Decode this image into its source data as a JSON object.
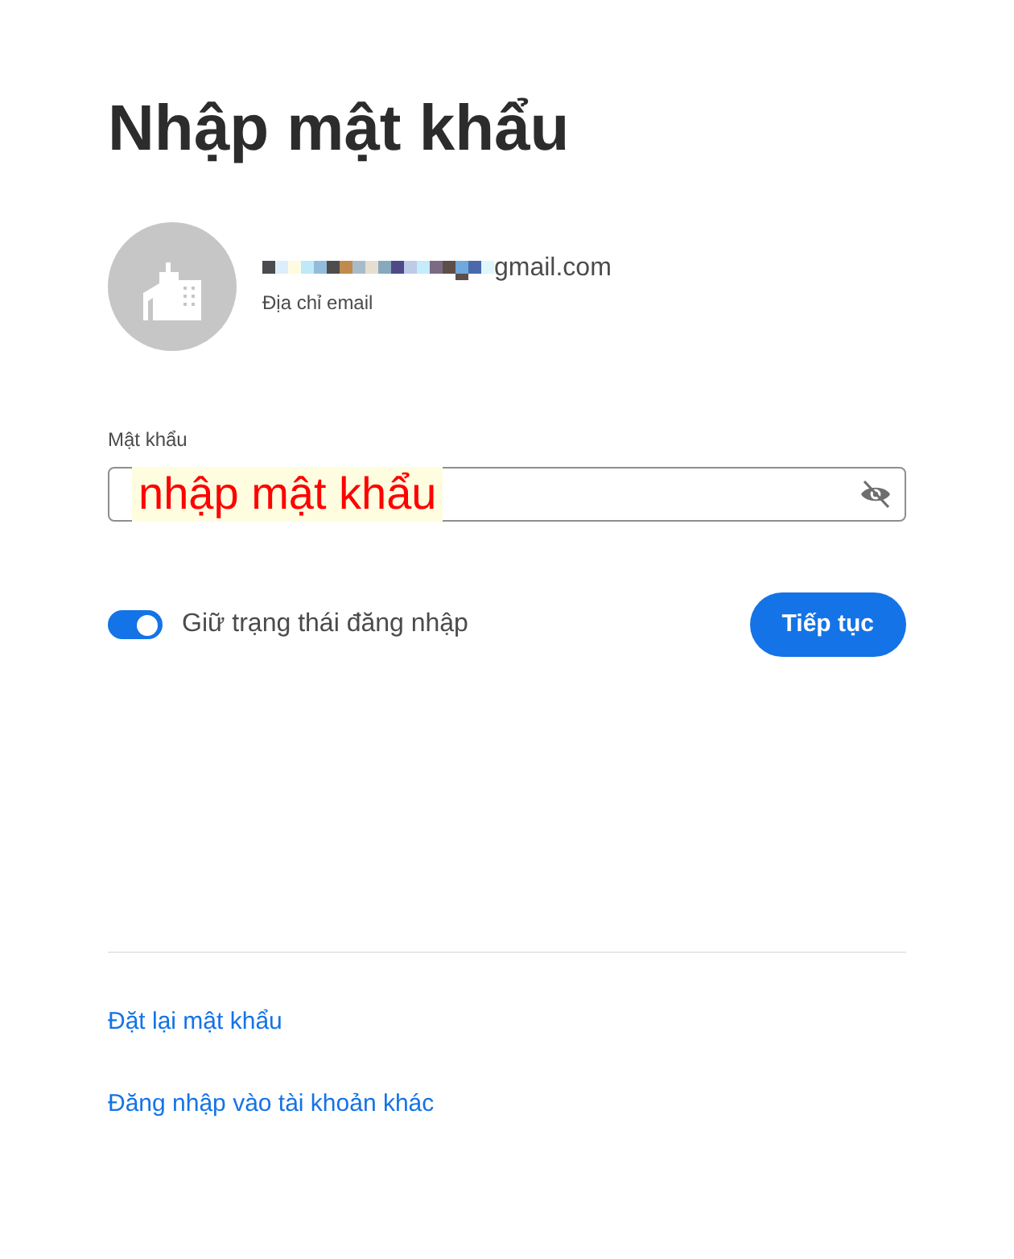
{
  "title": "Nhập mật khẩu",
  "account": {
    "email": "gmail.com",
    "caption": "Địa chỉ email"
  },
  "password": {
    "label": "Mật khẩu",
    "value": "nhập mật khẩu"
  },
  "stay_signed_in": {
    "label": "Giữ trạng thái đăng nhập",
    "on": true
  },
  "continue_button": "Tiếp tục",
  "links": [
    "Đặt lại mật khẩu",
    "Đăng nhập vào tài khoản khác"
  ]
}
